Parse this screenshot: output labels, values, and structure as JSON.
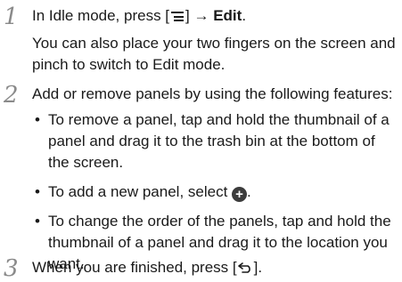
{
  "steps": [
    {
      "number": "1",
      "instruction_prefix": "In Idle mode, press [",
      "instruction_mid": "] → ",
      "instruction_bold": "Edit",
      "instruction_suffix": ".",
      "note_line1": "You can also place your two fingers on the screen and",
      "note_line2": "pinch to switch to Edit mode."
    },
    {
      "number": "2",
      "instruction": "Add or remove panels by using the following features:",
      "bullets": [
        {
          "dot": "•",
          "line1": "To remove a panel, tap and hold the thumbnail of a",
          "line2": "panel and drag it to the trash bin at the bottom of",
          "line3": "the screen."
        },
        {
          "dot": "•",
          "text_prefix": "To add a new panel, select ",
          "icon": "add-circle-icon",
          "icon_glyph": "+",
          "text_suffix": "."
        },
        {
          "dot": "•",
          "line1": "To change the order of the panels, tap and hold the",
          "line2": "thumbnail of a panel and drag it to the location you",
          "line3": "want."
        }
      ]
    },
    {
      "number": "3",
      "instruction_prefix": "When you are finished, press [",
      "icon": "back-key-icon",
      "instruction_suffix": "]."
    }
  ]
}
